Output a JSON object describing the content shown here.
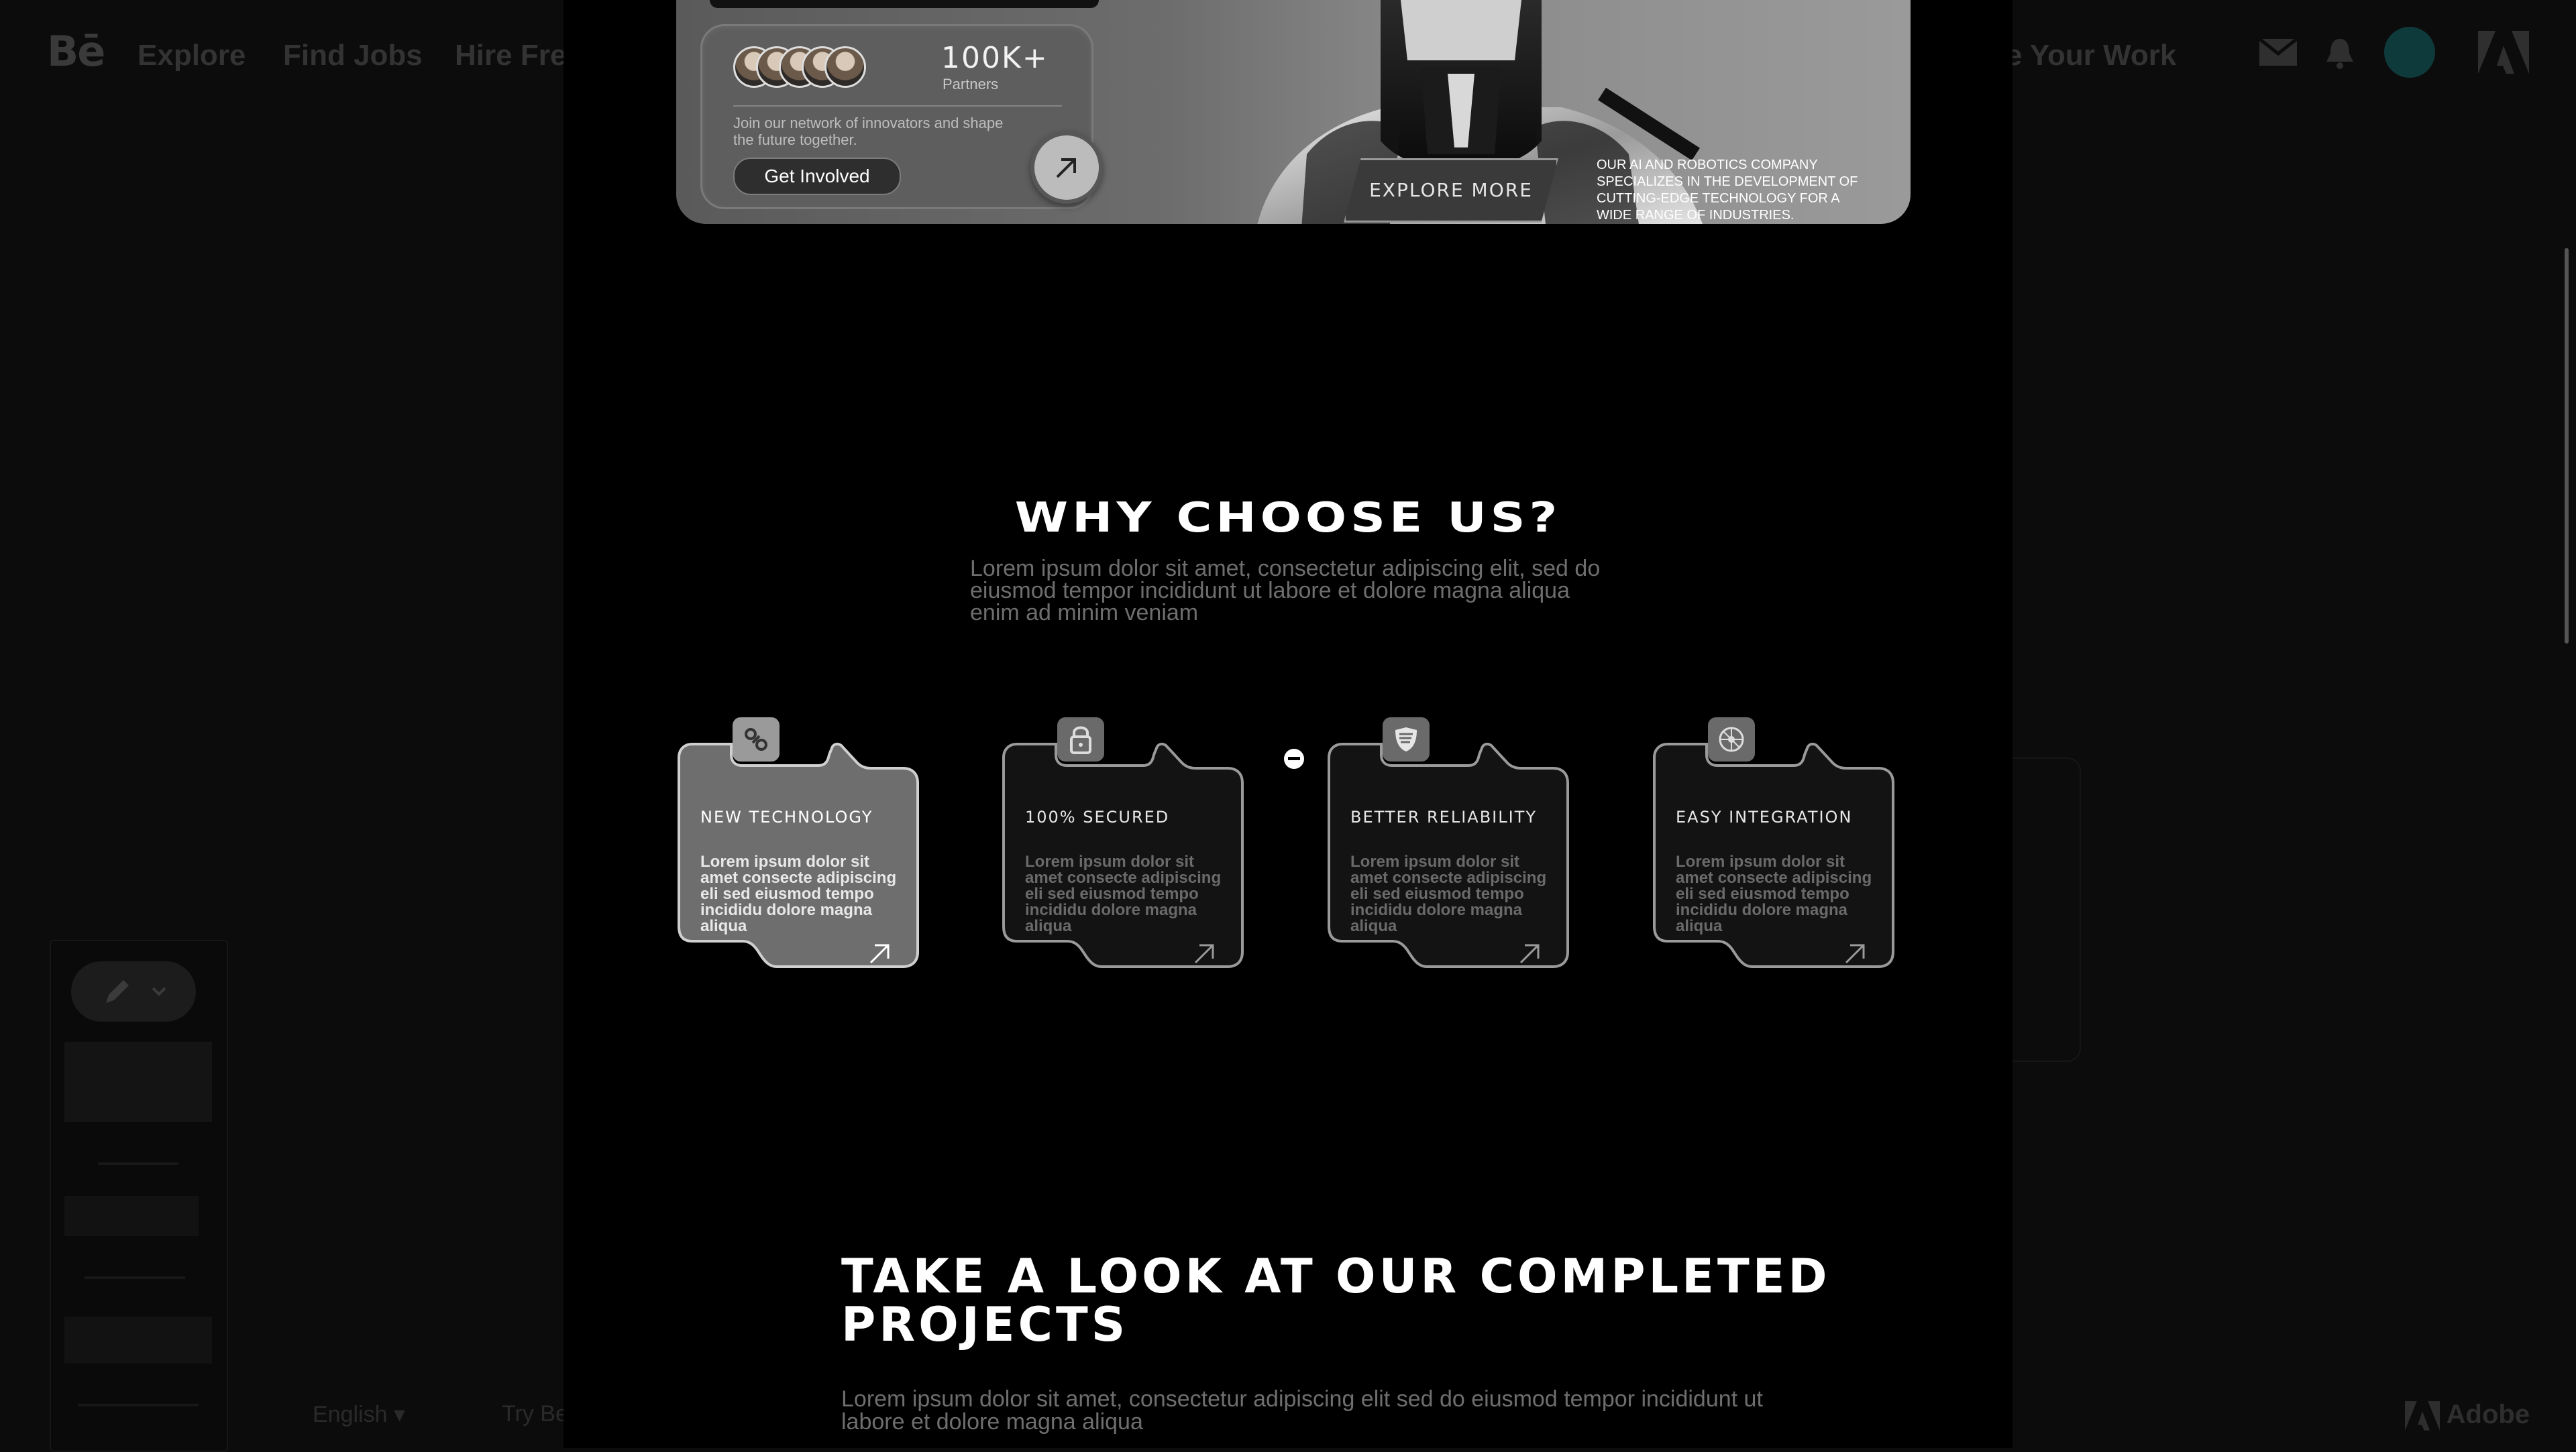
{
  "behance": {
    "logo": "Bē",
    "nav": [
      "Explore",
      "Find Jobs",
      "Hire Fre"
    ],
    "share_partial": "e Your Work",
    "footer_language": "English ▾",
    "footer_try": "Try Be",
    "footer_brand": "Adobe"
  },
  "hero": {
    "stat": "100K+",
    "stat_label": "Partners",
    "card_text": "Join our network of innovators and shape the future together.",
    "cta": "Get Involved",
    "explore": "EXPLORE MORE",
    "description": "OUR AI AND ROBOTICS COMPANY SPECIALIZES IN THE DEVELOPMENT OF CUTTING-EDGE TECHNOLOGY FOR A WIDE RANGE OF INDUSTRIES."
  },
  "why": {
    "title": "WHY CHOOSE US?",
    "subtitle": "Lorem ipsum dolor sit amet, consectetur adipiscing elit, sed do eiusmod tempor incididunt ut labore et dolore magna aliqua enim ad minim veniam"
  },
  "features": [
    {
      "title": "NEW TECHNOLOGY",
      "text": "Lorem ipsum dolor sit amet consecte adipiscing eli sed eiusmod tempo incididu dolore magna aliqua",
      "icon": "link-icon",
      "active": true
    },
    {
      "title": "100% SECURED",
      "text": "Lorem ipsum dolor sit amet consecte adipiscing eli sed eiusmod tempo incididu dolore magna aliqua",
      "icon": "lock-icon",
      "active": false
    },
    {
      "title": "BETTER RELIABILITY",
      "text": "Lorem ipsum dolor sit amet consecte adipiscing eli sed eiusmod tempo incididu dolore magna aliqua",
      "icon": "shield-icon",
      "active": false
    },
    {
      "title": "EASY INTEGRATION",
      "text": "Lorem ipsum dolor sit amet consecte adipiscing eli sed eiusmod tempo incididu dolore magna aliqua",
      "icon": "network-icon",
      "active": false
    }
  ],
  "projects": {
    "title": "TAKE A LOOK AT OUR COMPLETED PROJECTS",
    "subtitle": "Lorem ipsum dolor sit amet, consectetur adipiscing elit sed do eiusmod tempor incididunt ut labore et dolore magna aliqua"
  },
  "colors": {
    "background": "#000000",
    "active_card": "#6e6e6e",
    "inactive_card": "#141414",
    "dim_text": "#6e6e6e"
  }
}
